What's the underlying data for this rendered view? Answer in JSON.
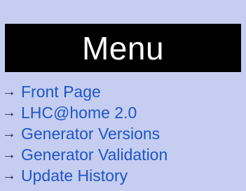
{
  "menu": {
    "title": "Menu",
    "items": [
      {
        "arrow": "→",
        "label": "Front Page"
      },
      {
        "arrow": "→",
        "label": "LHC@home 2.0"
      },
      {
        "arrow": "→",
        "label": "Generator Versions"
      },
      {
        "arrow": "→",
        "label": "Generator Validation"
      },
      {
        "arrow": "→",
        "label": "Update History"
      }
    ]
  },
  "colors": {
    "panel_background": "#c5cef0",
    "header_background": "#000000",
    "header_text": "#ffffff",
    "link": "#1f55c8",
    "arrow": "#1e2a52"
  }
}
